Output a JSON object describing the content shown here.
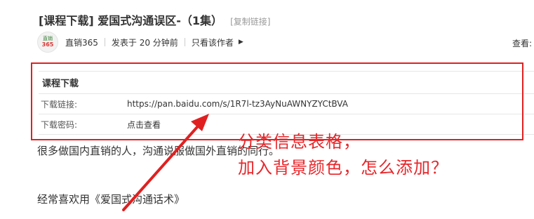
{
  "title": {
    "text": "[课程下载] 爱国式沟通误区-（1集）",
    "copy_link": "[复制链接]"
  },
  "meta": {
    "avatar_top": "直销",
    "avatar_num": "365",
    "author": "直销365",
    "posted": "发表于 20 分钟前",
    "only_author": "只看该作者",
    "view_label": "查看:"
  },
  "table": {
    "header": "课程下载",
    "rows": [
      {
        "label": "下载链接:",
        "value": "https://pan.baidu.com/s/1R7l-tz3AyNuAWNYZYCtBVA"
      },
      {
        "label": "下载密码:",
        "value": "点击查看"
      }
    ]
  },
  "body": {
    "paragraph1": "很多做国内直销的人，沟通说服做国外直销的同行。",
    "paragraph2": "经常喜欢用《爱国式沟通话术》"
  },
  "annotation": {
    "line1": "分类信息表格，",
    "line2": "加入背景颜色，怎么添加？",
    "color": "#e8262a"
  },
  "colors": {
    "highlight_border": "#e02020",
    "table_border": "#e6e6e6"
  }
}
